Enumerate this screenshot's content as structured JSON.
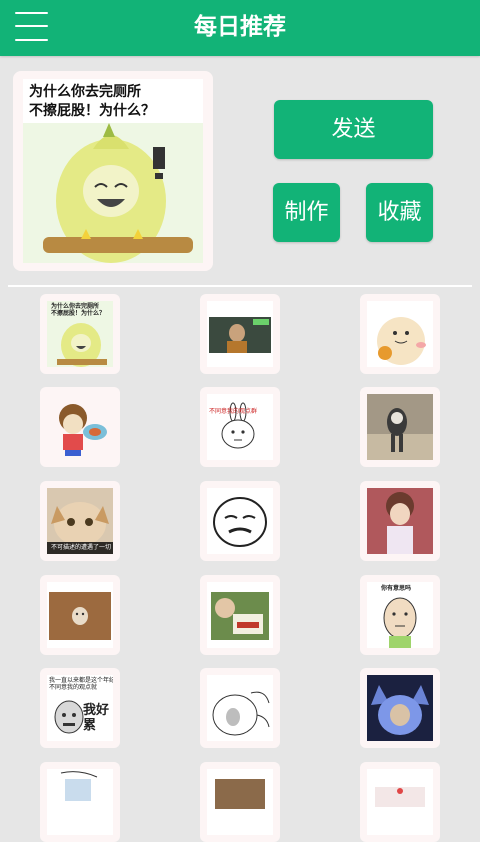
{
  "header": {
    "title": "每日推荐"
  },
  "preview": {
    "caption": "为什么你去完厕所\n不擦屁股！为什么？"
  },
  "actions": {
    "send_label": "发送",
    "make_label": "制作",
    "favorite_label": "收藏"
  },
  "grid": {
    "captions": {
      "item1": "为什么你去完厕所\n不擦屁股！为什么？",
      "item5": "不同意我的观点群",
      "item7": "不可描述的遭遇了一切",
      "item11": "你有意思吗",
      "item13": "我一直以来都是这个年纪\n不同意我的观点就",
      "item13_big": "我好累"
    }
  },
  "colors": {
    "brand_green": "#12b377",
    "background": "#e6e6e6",
    "card_bg": "#fdf5f5"
  }
}
